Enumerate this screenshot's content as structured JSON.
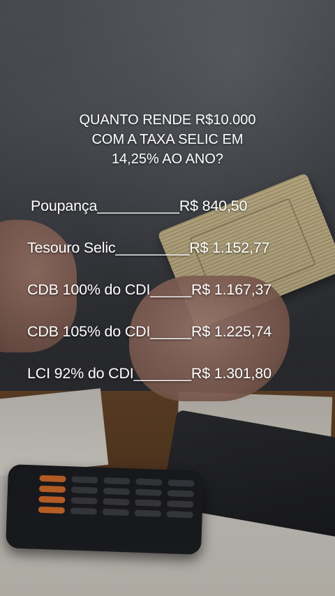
{
  "title": {
    "lines": [
      "QUANTO RENDE R$10.000",
      "COM A TAXA SELIC EM",
      "14,25% AO ANO?"
    ]
  },
  "investments": [
    {
      "label": "Poupança",
      "separator": "__________",
      "value": "R$ 840,50"
    },
    {
      "label": "Tesouro Selic",
      "separator": "_________",
      "value": "R$ 1.152,77"
    },
    {
      "label": "CDB 100% do CDI",
      "separator": "_____",
      "value": "R$ 1.167,37"
    },
    {
      "label": "CDB 105% do CDI",
      "separator": "_____",
      "value": "R$ 1.225,74"
    },
    {
      "label": "LCI 92% do CDI",
      "separator": "_______",
      "value": "R$ 1.301,80"
    }
  ]
}
